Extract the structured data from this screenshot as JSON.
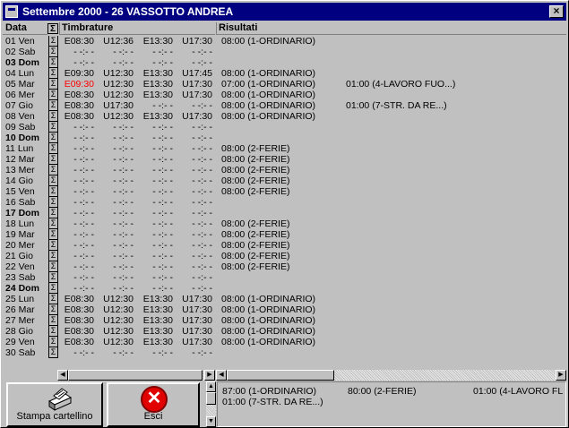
{
  "window": {
    "title": "Settembre 2000 - 26 VASSOTTO ANDREA",
    "close_label": "×"
  },
  "headers": {
    "data": "Data",
    "sigma": "Σ",
    "timbrature": "Timbrature",
    "risultati": "Risultati"
  },
  "rows": [
    {
      "d": "01 Ven",
      "bold": false,
      "t": [
        "E08:30",
        "U12:36",
        "E13:30",
        "U17:30"
      ],
      "r": [
        "08:00 (1-ORDINARIO)",
        ""
      ]
    },
    {
      "d": "02 Sab",
      "bold": false,
      "t": [
        "- -:- -",
        "- -:- -",
        "- -:- -",
        "- -:- -"
      ],
      "r": [
        "",
        ""
      ]
    },
    {
      "d": "03 Dom",
      "bold": true,
      "t": [
        "- -:- -",
        "- -:- -",
        "- -:- -",
        "- -:- -"
      ],
      "r": [
        "",
        ""
      ]
    },
    {
      "d": "04 Lun",
      "bold": false,
      "t": [
        "E09:30",
        "U12:30",
        "E13:30",
        "U17:45"
      ],
      "r": [
        "08:00 (1-ORDINARIO)",
        ""
      ]
    },
    {
      "d": "05 Mar",
      "bold": false,
      "t": [
        "E09:30",
        "U12:30",
        "E13:30",
        "U17:30"
      ],
      "red0": true,
      "r": [
        "07:00 (1-ORDINARIO)",
        "01:00 (4-LAVORO FUO...)"
      ]
    },
    {
      "d": "06 Mer",
      "bold": false,
      "t": [
        "E08:30",
        "U12:30",
        "E13:30",
        "U17:30"
      ],
      "r": [
        "08:00 (1-ORDINARIO)",
        ""
      ]
    },
    {
      "d": "07 Gio",
      "bold": false,
      "t": [
        "E08:30",
        "U17:30",
        "- -:- -",
        "- -:- -"
      ],
      "r": [
        "08:00 (1-ORDINARIO)",
        "01:00 (7-STR. DA RE...)"
      ]
    },
    {
      "d": "08 Ven",
      "bold": false,
      "t": [
        "E08:30",
        "U12:30",
        "E13:30",
        "U17:30"
      ],
      "r": [
        "08:00 (1-ORDINARIO)",
        ""
      ]
    },
    {
      "d": "09 Sab",
      "bold": false,
      "t": [
        "- -:- -",
        "- -:- -",
        "- -:- -",
        "- -:- -"
      ],
      "r": [
        "",
        ""
      ]
    },
    {
      "d": "10 Dom",
      "bold": true,
      "t": [
        "- -:- -",
        "- -:- -",
        "- -:- -",
        "- -:- -"
      ],
      "r": [
        "",
        ""
      ]
    },
    {
      "d": "11 Lun",
      "bold": false,
      "t": [
        "- -:- -",
        "- -:- -",
        "- -:- -",
        "- -:- -"
      ],
      "r": [
        "08:00 (2-FERIE)",
        ""
      ]
    },
    {
      "d": "12 Mar",
      "bold": false,
      "t": [
        "- -:- -",
        "- -:- -",
        "- -:- -",
        "- -:- -"
      ],
      "r": [
        "08:00 (2-FERIE)",
        ""
      ]
    },
    {
      "d": "13 Mer",
      "bold": false,
      "t": [
        "- -:- -",
        "- -:- -",
        "- -:- -",
        "- -:- -"
      ],
      "r": [
        "08:00 (2-FERIE)",
        ""
      ]
    },
    {
      "d": "14 Gio",
      "bold": false,
      "t": [
        "- -:- -",
        "- -:- -",
        "- -:- -",
        "- -:- -"
      ],
      "r": [
        "08:00 (2-FERIE)",
        ""
      ]
    },
    {
      "d": "15 Ven",
      "bold": false,
      "t": [
        "- -:- -",
        "- -:- -",
        "- -:- -",
        "- -:- -"
      ],
      "r": [
        "08:00 (2-FERIE)",
        ""
      ]
    },
    {
      "d": "16 Sab",
      "bold": false,
      "t": [
        "- -:- -",
        "- -:- -",
        "- -:- -",
        "- -:- -"
      ],
      "r": [
        "",
        ""
      ]
    },
    {
      "d": "17 Dom",
      "bold": true,
      "t": [
        "- -:- -",
        "- -:- -",
        "- -:- -",
        "- -:- -"
      ],
      "r": [
        "",
        ""
      ]
    },
    {
      "d": "18 Lun",
      "bold": false,
      "t": [
        "- -:- -",
        "- -:- -",
        "- -:- -",
        "- -:- -"
      ],
      "r": [
        "08:00 (2-FERIE)",
        ""
      ]
    },
    {
      "d": "19 Mar",
      "bold": false,
      "t": [
        "- -:- -",
        "- -:- -",
        "- -:- -",
        "- -:- -"
      ],
      "r": [
        "08:00 (2-FERIE)",
        ""
      ]
    },
    {
      "d": "20 Mer",
      "bold": false,
      "t": [
        "- -:- -",
        "- -:- -",
        "- -:- -",
        "- -:- -"
      ],
      "r": [
        "08:00 (2-FERIE)",
        ""
      ]
    },
    {
      "d": "21 Gio",
      "bold": false,
      "t": [
        "- -:- -",
        "- -:- -",
        "- -:- -",
        "- -:- -"
      ],
      "r": [
        "08:00 (2-FERIE)",
        ""
      ]
    },
    {
      "d": "22 Ven",
      "bold": false,
      "t": [
        "- -:- -",
        "- -:- -",
        "- -:- -",
        "- -:- -"
      ],
      "r": [
        "08:00 (2-FERIE)",
        ""
      ]
    },
    {
      "d": "23 Sab",
      "bold": false,
      "t": [
        "- -:- -",
        "- -:- -",
        "- -:- -",
        "- -:- -"
      ],
      "r": [
        "",
        ""
      ]
    },
    {
      "d": "24 Dom",
      "bold": true,
      "t": [
        "- -:- -",
        "- -:- -",
        "- -:- -",
        "- -:- -"
      ],
      "r": [
        "",
        ""
      ]
    },
    {
      "d": "25 Lun",
      "bold": false,
      "t": [
        "E08:30",
        "U12:30",
        "E13:30",
        "U17:30"
      ],
      "r": [
        "08:00 (1-ORDINARIO)",
        ""
      ]
    },
    {
      "d": "26 Mar",
      "bold": false,
      "t": [
        "E08:30",
        "U12:30",
        "E13:30",
        "U17:30"
      ],
      "r": [
        "08:00 (1-ORDINARIO)",
        ""
      ]
    },
    {
      "d": "27 Mer",
      "bold": false,
      "t": [
        "E08:30",
        "U12:30",
        "E13:30",
        "U17:30"
      ],
      "r": [
        "08:00 (1-ORDINARIO)",
        ""
      ]
    },
    {
      "d": "28 Gio",
      "bold": false,
      "t": [
        "E08:30",
        "U12:30",
        "E13:30",
        "U17:30"
      ],
      "r": [
        "08:00 (1-ORDINARIO)",
        ""
      ]
    },
    {
      "d": "29 Ven",
      "bold": false,
      "t": [
        "E08:30",
        "U12:30",
        "E13:30",
        "U17:30"
      ],
      "r": [
        "08:00 (1-ORDINARIO)",
        ""
      ]
    },
    {
      "d": "30 Sab",
      "bold": false,
      "t": [
        "- -:- -",
        "- -:- -",
        "- -:- -",
        "- -:- -"
      ],
      "r": [
        "",
        ""
      ]
    }
  ],
  "sigma_symbol": "Σ",
  "buttons": {
    "stampa": "Stampa cartellino",
    "esci": "Esci"
  },
  "summary": {
    "line1": [
      "87:00 (1-ORDINARIO)",
      "80:00 (2-FERIE)",
      "01:00 (4-LAVORO FL"
    ],
    "line2": [
      "01:00 (7-STR. DA RE...)"
    ]
  },
  "colors": {
    "title_bar": "#000080",
    "red_value": "#ff0000",
    "exit_icon": "#e00000"
  }
}
